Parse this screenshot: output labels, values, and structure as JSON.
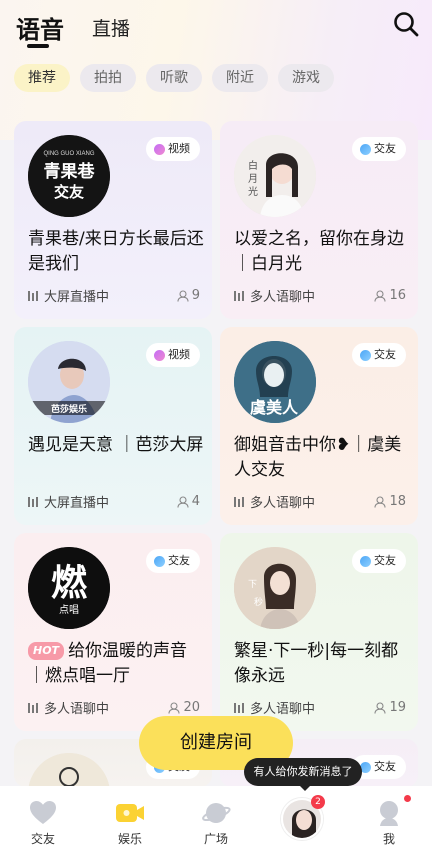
{
  "header": {
    "tab_voice": "语音",
    "tab_live": "直播"
  },
  "chips": [
    "推荐",
    "拍拍",
    "听歌",
    "附近",
    "游戏"
  ],
  "cards": [
    {
      "badge": "视频",
      "title": "青果巷/来日方长最后还是我们",
      "meta": "大屏直播中",
      "count": "9",
      "cover_text": "青果巷\n交友",
      "cover_sub": "QING GUO XIANG"
    },
    {
      "badge": "交友",
      "title": "以爱之名，留你在身边｜白月光",
      "meta": "多人语聊中",
      "count": "16",
      "cover_text": "白月光"
    },
    {
      "badge": "视频",
      "title": "遇见是天意 ｜芭莎大屏",
      "meta": "大屏直播中",
      "count": "4",
      "cover_text": "芭莎娱乐"
    },
    {
      "badge": "交友",
      "title": "御姐音击中你❥｜虞美人交友",
      "meta": "多人语聊中",
      "count": "18",
      "cover_text": "虞美人"
    },
    {
      "badge": "交友",
      "hot": "HOT",
      "title": "给你温暖的声音｜燃点唱一厅",
      "meta": "多人语聊中",
      "count": "20",
      "cover_text": "燃",
      "cover_sub": "点唱"
    },
    {
      "badge": "交友",
      "title": "繁星·下一秒|每一刻都像永远",
      "meta": "多人语聊中",
      "count": "19",
      "cover_text": "下一秒"
    },
    {
      "badge": "交友",
      "title": "",
      "meta": "",
      "count": ""
    },
    {
      "badge": "交友",
      "title": "",
      "meta": "",
      "count": ""
    }
  ],
  "create_room": "创建房间",
  "toast": "有人给你发新消息了",
  "nav": {
    "items": [
      "交友",
      "娱乐",
      "广场",
      "",
      "我"
    ],
    "badge_count": "2"
  },
  "colors": {
    "accent_yellow": "#fbe05a",
    "badge_red": "#f43a4a",
    "chip_active": "#fbf3c7"
  }
}
